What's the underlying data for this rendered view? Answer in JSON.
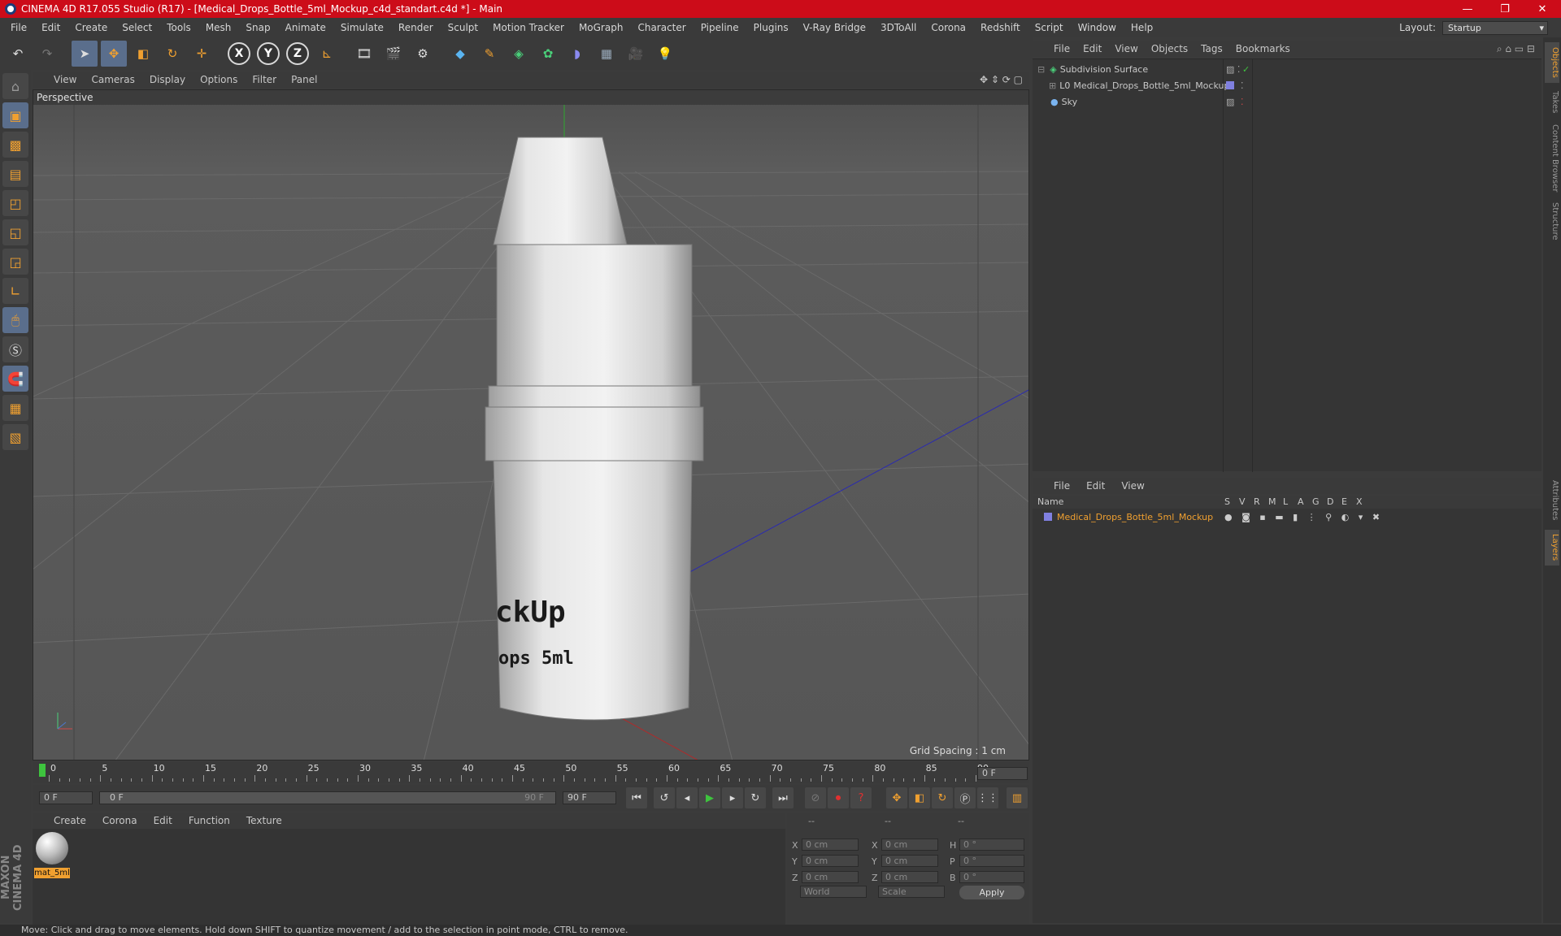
{
  "window": {
    "title": "CINEMA 4D R17.055 Studio (R17) - [Medical_Drops_Bottle_5ml_Mockup_c4d_standart.c4d *] - Main",
    "buttons": [
      "—",
      "❐",
      "✕"
    ]
  },
  "menubar": {
    "items": [
      "File",
      "Edit",
      "Create",
      "Select",
      "Tools",
      "Mesh",
      "Snap",
      "Animate",
      "Simulate",
      "Render",
      "Sculpt",
      "Motion Tracker",
      "MoGraph",
      "Character",
      "Pipeline",
      "Plugins",
      "V-Ray Bridge",
      "3DToAll",
      "Corona",
      "Redshift",
      "Script",
      "Window",
      "Help"
    ],
    "layout_label": "Layout:",
    "layout_value": "Startup"
  },
  "toolbar": {
    "icons": [
      "undo-icon",
      "redo-icon",
      "select-arrow-icon",
      "move-icon",
      "scale-icon",
      "rotate-icon",
      "transform-icon",
      "x-axis",
      "y-axis",
      "z-axis",
      "coordinate-system-icon",
      "render-view-icon",
      "render-picture-viewer-icon",
      "render-settings-icon",
      "cube-icon",
      "pen-spline-icon",
      "subdivision-icon",
      "mograph-cloner-icon",
      "deformer-icon",
      "floor-icon",
      "camera-icon",
      "light-icon"
    ],
    "x": "X",
    "y": "Y",
    "z": "Z"
  },
  "viewport": {
    "menu": [
      "View",
      "Cameras",
      "Display",
      "Options",
      "Filter",
      "Panel"
    ],
    "label": "Perspective",
    "grid_spacing": "Grid Spacing : 1 cm",
    "label_text1": "ckUp",
    "label_text2": "ops 5ml"
  },
  "timeline": {
    "ticks": [
      "0",
      "5",
      "10",
      "15",
      "20",
      "25",
      "30",
      "35",
      "40",
      "45",
      "50",
      "55",
      "60",
      "65",
      "70",
      "75",
      "80",
      "85",
      "90"
    ],
    "current_frame_field": "0 F"
  },
  "transport": {
    "start": "0 F",
    "range_start": "0 F",
    "range_end": "90 F",
    "end": "90 F"
  },
  "material_manager": {
    "menu": [
      "Create",
      "Corona",
      "Edit",
      "Function",
      "Texture"
    ],
    "materials": [
      {
        "name": "mat_5ml"
      }
    ]
  },
  "coordinates": {
    "header": [
      "--",
      "--",
      "--"
    ],
    "rows": [
      {
        "axis": "X",
        "pos": "0 cm",
        "axis2": "X",
        "size": "0 cm",
        "rot_axis": "H",
        "rot": "0 °"
      },
      {
        "axis": "Y",
        "pos": "0 cm",
        "axis2": "Y",
        "size": "0 cm",
        "rot_axis": "P",
        "rot": "0 °"
      },
      {
        "axis": "Z",
        "pos": "0 cm",
        "axis2": "Z",
        "size": "0 cm",
        "rot_axis": "B",
        "rot": "0 °"
      }
    ],
    "mode1": "World",
    "mode2": "Scale",
    "apply": "Apply"
  },
  "object_manager": {
    "menu": [
      "File",
      "Edit",
      "View",
      "Objects",
      "Tags",
      "Bookmarks"
    ],
    "objects": [
      {
        "name": "Subdivision Surface",
        "indent": 0
      },
      {
        "name": "Medical_Drops_Bottle_5ml_Mockup",
        "indent": 1
      },
      {
        "name": "Sky",
        "indent": 0
      }
    ]
  },
  "layer_manager": {
    "menu": [
      "File",
      "Edit",
      "View"
    ],
    "columns": [
      "Name",
      "S",
      "V",
      "R",
      "M",
      "L",
      "A",
      "G",
      "D",
      "E",
      "X"
    ],
    "layers": [
      {
        "name": "Medical_Drops_Bottle_5ml_Mockup",
        "color": "#8080e0"
      }
    ]
  },
  "right_tabs": [
    "Objects",
    "Takes",
    "Content Browser",
    "Structure",
    "Attributes",
    "Layers"
  ],
  "status": "Move: Click and drag to move elements. Hold down SHIFT to quantize movement / add to the selection in point mode, CTRL to remove.",
  "brand": "MAXON CINEMA 4D",
  "colors": {
    "accent": "#f0a030",
    "title_bar": "#cc0c19",
    "selection": "#5a6e8c"
  }
}
